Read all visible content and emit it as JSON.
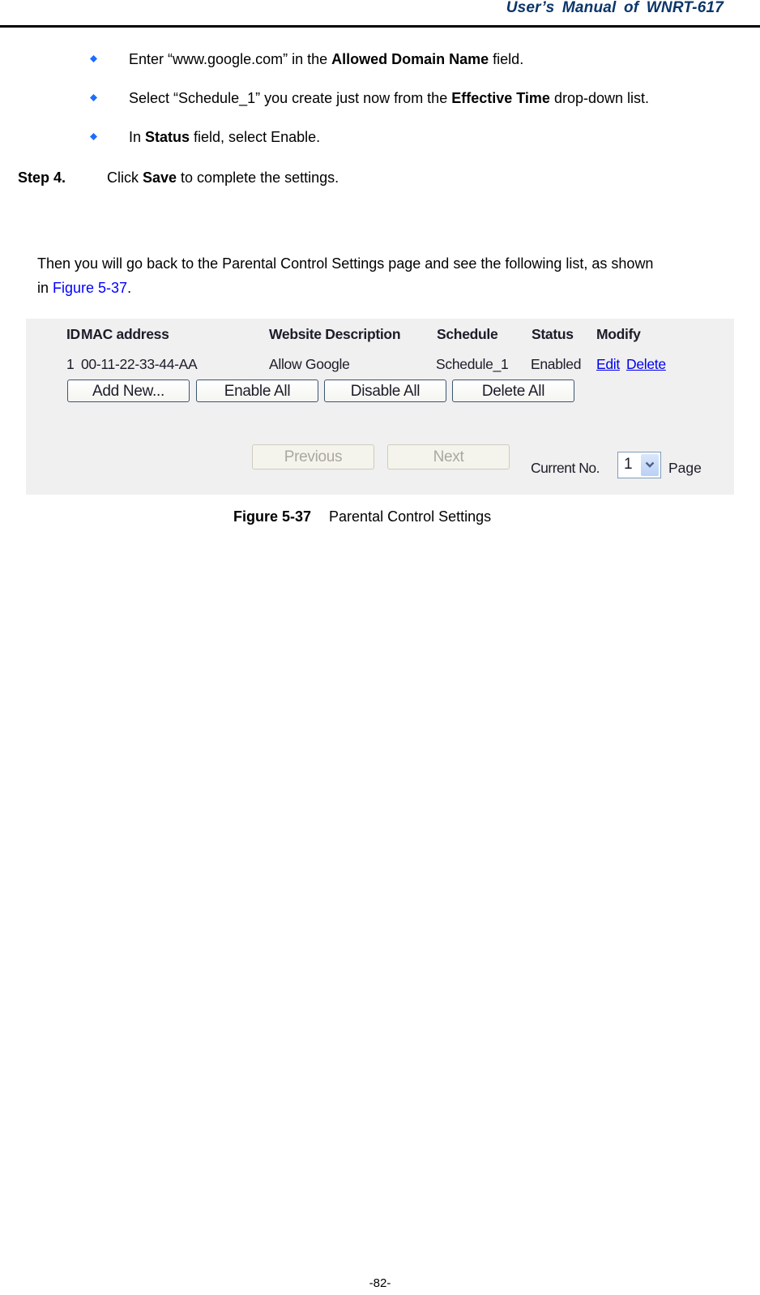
{
  "header": {
    "title": "User’s  Manual  of  WNRT-617"
  },
  "bullets": [
    {
      "icon": "diamond-bullet-icon",
      "before": "Enter “www.google.com” in the ",
      "bold": "Allowed Domain Name",
      "after": " field."
    },
    {
      "icon": "diamond-bullet-icon",
      "before": "Select “Schedule_1” you create just now from the ",
      "bold": "Effective Time",
      "after": " drop-down list."
    },
    {
      "icon": "diamond-bullet-icon",
      "before": "In ",
      "bold": "Status",
      "after": " field, select Enable."
    }
  ],
  "step": {
    "label": "Step 4.",
    "before": "Click ",
    "bold": "Save",
    "after": " to complete the settings."
  },
  "paragraph": {
    "line1": "Then you will go back to the Parental Control Settings page and see the following list, as shown",
    "line2_before": "in ",
    "line2_link": "Figure 5-37",
    "line2_after": "."
  },
  "figure": {
    "table": {
      "headers": {
        "id": "ID",
        "mac": "MAC address",
        "description": "Website Description",
        "schedule": "Schedule",
        "status": "Status",
        "modify": "Modify"
      },
      "rows": [
        {
          "id": "1",
          "mac": "00-11-22-33-44-AA",
          "description": "Allow Google",
          "schedule": "Schedule_1",
          "status": "Enabled",
          "edit": "Edit",
          "delete": "Delete"
        }
      ]
    },
    "buttons": {
      "add_new": "Add New...",
      "enable_all": "Enable All",
      "disable_all": "Disable All",
      "delete_all": "Delete All",
      "previous": "Previous",
      "next": "Next"
    },
    "pagination": {
      "current_label": "Current No.",
      "current_value": "1",
      "page_label": "Page"
    }
  },
  "caption": {
    "number": "Figure 5-37",
    "title": "Parental Control Settings"
  },
  "footer": {
    "page_number": "-82-"
  },
  "colors": {
    "header_title": "#0a3569",
    "bullet": "#1a6dff",
    "link": "#0000ff",
    "figure_bg": "#f0f0f0"
  }
}
